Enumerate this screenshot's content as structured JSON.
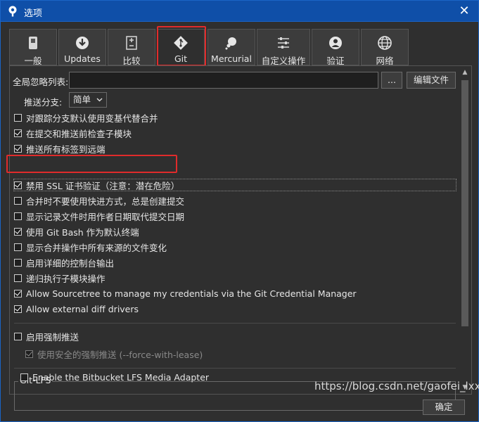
{
  "window": {
    "title": "选项",
    "close_glyph": "✕"
  },
  "tabs": [
    {
      "label": "一般",
      "icon": "switch-icon"
    },
    {
      "label": "Updates",
      "icon": "download-icon"
    },
    {
      "label": "比较",
      "icon": "diff-icon"
    },
    {
      "label": "Git",
      "icon": "git-icon",
      "active": true
    },
    {
      "label": "Mercurial",
      "icon": "mercurial-icon"
    },
    {
      "label": "自定义操作",
      "icon": "custom-actions-icon"
    },
    {
      "label": "验证",
      "icon": "user-icon"
    },
    {
      "label": "网络",
      "icon": "globe-icon"
    }
  ],
  "ignore": {
    "label": "全局忽略列表:",
    "value": "",
    "browse_label": "...",
    "edit_label": "编辑文件"
  },
  "push_branch": {
    "label": "推送分支:",
    "value": "简单"
  },
  "options": [
    {
      "label": "对跟踪分支默认使用变基代替合并",
      "checked": false
    },
    {
      "label": "在提交和推送前检查子模块",
      "checked": true
    },
    {
      "label": "推送所有标签到远端",
      "checked": true
    },
    {
      "label": "禁用 SSL 证书验证（注意：潜在危险）",
      "checked": true
    },
    {
      "label": "合并时不要使用快进方式，总是创建提交",
      "checked": false
    },
    {
      "label": "显示记录文件时用作者日期取代提交日期",
      "checked": false
    },
    {
      "label": "使用 Git Bash 作为默认终端",
      "checked": true
    },
    {
      "label": "显示合并操作中所有来源的文件变化",
      "checked": false
    },
    {
      "label": "启用详细的控制台输出",
      "checked": false
    },
    {
      "label": "递归执行子模块操作",
      "checked": false
    },
    {
      "label": "Allow Sourcetree to manage my credentials via the Git Credential Manager",
      "checked": true
    },
    {
      "label": "Allow external diff drivers",
      "checked": true
    }
  ],
  "force_push": {
    "label": "启用强制推送",
    "checked": false,
    "safe_label": "使用安全的强制推送 (--force-with-lease)",
    "safe_checked": true
  },
  "git_lfs": {
    "group_label": "Git-LFS",
    "adapter_label": "Enable the Bitbucket LFS Media Adapter",
    "checked": false
  },
  "footer": {
    "ok_label": "确定",
    "watermark": "https://blog.csdn.net/gaofei_lxx"
  },
  "colors": {
    "highlight": "#e02b2b",
    "titlebar": "#0f4fa8"
  }
}
